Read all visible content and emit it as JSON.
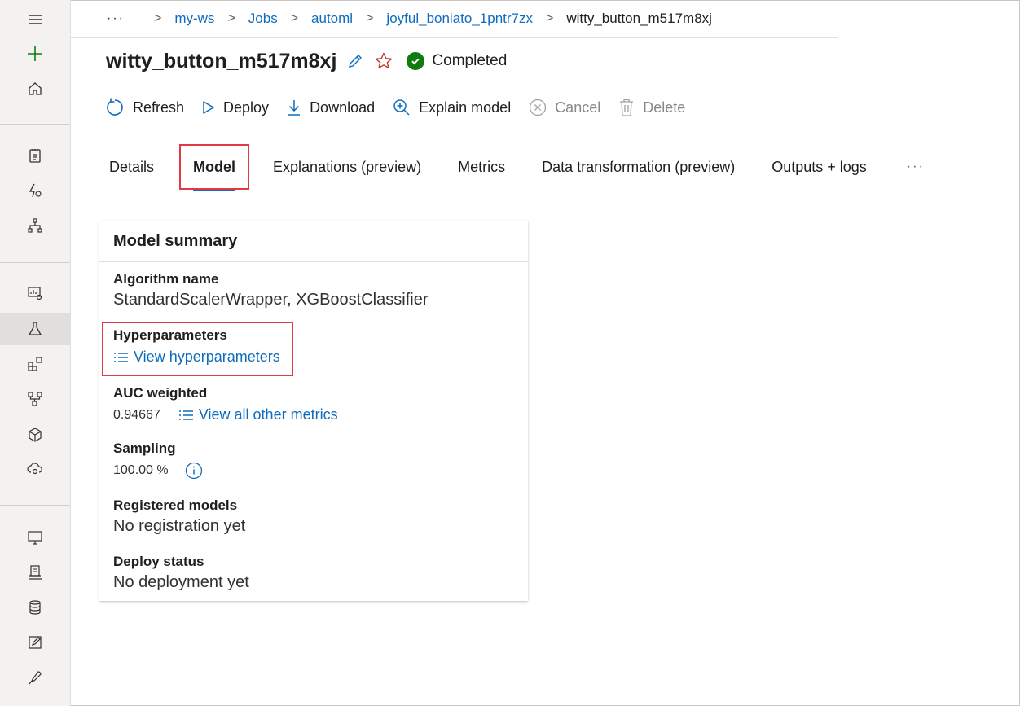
{
  "breadcrumb": {
    "more": "···",
    "items": [
      "my-ws",
      "Jobs",
      "automl",
      "joyful_boniato_1pntr7zx"
    ],
    "current": "witty_button_m517m8xj"
  },
  "header": {
    "title": "witty_button_m517m8xj",
    "status": "Completed"
  },
  "toolbar": {
    "refresh": "Refresh",
    "deploy": "Deploy",
    "download": "Download",
    "explain": "Explain model",
    "cancel": "Cancel",
    "delete": "Delete"
  },
  "tabs": {
    "details": "Details",
    "model": "Model",
    "explanations": "Explanations (preview)",
    "metrics": "Metrics",
    "data_transformation": "Data transformation (preview)",
    "outputs": "Outputs + logs",
    "more": "···"
  },
  "card": {
    "title": "Model summary",
    "algorithm_label": "Algorithm name",
    "algorithm_value": "StandardScalerWrapper, XGBoostClassifier",
    "hyper_label": "Hyperparameters",
    "hyper_link": "View hyperparameters",
    "auc_label": "AUC weighted",
    "auc_value": "0.94667",
    "metrics_link": "View all other metrics",
    "sampling_label": "Sampling",
    "sampling_value": "100.00 %",
    "registered_label": "Registered models",
    "registered_value": "No registration yet",
    "deploy_label": "Deploy status",
    "deploy_value": "No deployment yet"
  },
  "colors": {
    "accent": "#0f6cbd",
    "success": "#107c10",
    "highlight": "#e03a4a"
  }
}
